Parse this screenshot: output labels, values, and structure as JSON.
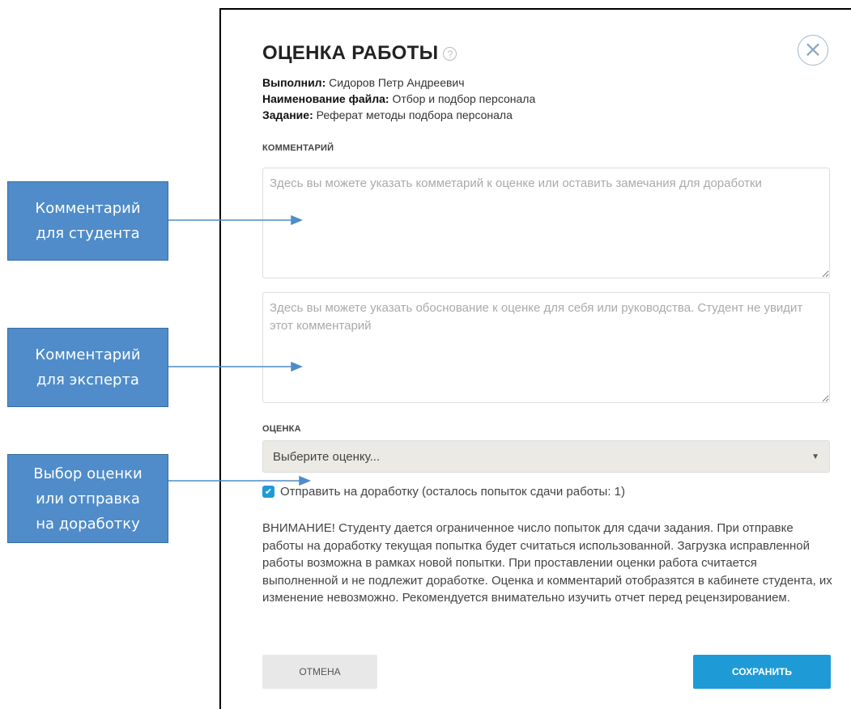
{
  "callouts": {
    "student": [
      "Комментарий",
      "для студента"
    ],
    "expert": [
      "Комментарий",
      "для эксперта"
    ],
    "grade": [
      "Выбор оценки",
      "или отправка",
      "на доработку"
    ]
  },
  "modal": {
    "title": "ОЦЕНКА РАБОТЫ",
    "help_icon": "?",
    "close_icon": "×",
    "performer_label": "Выполнил:",
    "performer_value": " Сидоров Петр Андреевич",
    "file_label": "Наименование файла:",
    "file_value": " Отбор и подбор персонала",
    "task_label": "Задание:",
    "task_value": " Реферат методы подбора персонала",
    "comment_section_label": "КОММЕНТАРИЙ",
    "student_comment_placeholder": "Здесь вы можете указать комметарий к оценке или оставить замечания для доработки",
    "expert_comment_placeholder": "Здесь вы можете указать обоснование к оценке для себя или руководства. Студент не увидит этот комментарий",
    "grade_section_label": "ОЦЕНКА",
    "grade_select_value": "Выберите оценку...",
    "caret_icon": "▼",
    "revision_checkbox_checked": true,
    "revision_checkbox_mark": "✔",
    "revision_label": "Отправить на доработку (осталось попыток сдачи работы: 1)",
    "warning_text": "ВНИМАНИЕ! Студенту дается ограниченное число попыток для сдачи задания. При отправке работы на доработку текущая попытка будет считаться использованной. Загрузка исправленной работы возможна в рамках новой попытки. При проставлении оценки работа считается выполненной и не подлежит доработке. Оценка и комментарий отобразятся в кабинете студента, их изменение невозможно. Рекомендуется внимательно изучить отчет перед рецензированием.",
    "cancel_label": "ОТМЕНА",
    "save_label": "СОХРАНИТЬ"
  },
  "colors": {
    "accent": "#1e9bd7",
    "callout_bg": "#4f8cc9",
    "arrow": "#4f8cc9"
  }
}
